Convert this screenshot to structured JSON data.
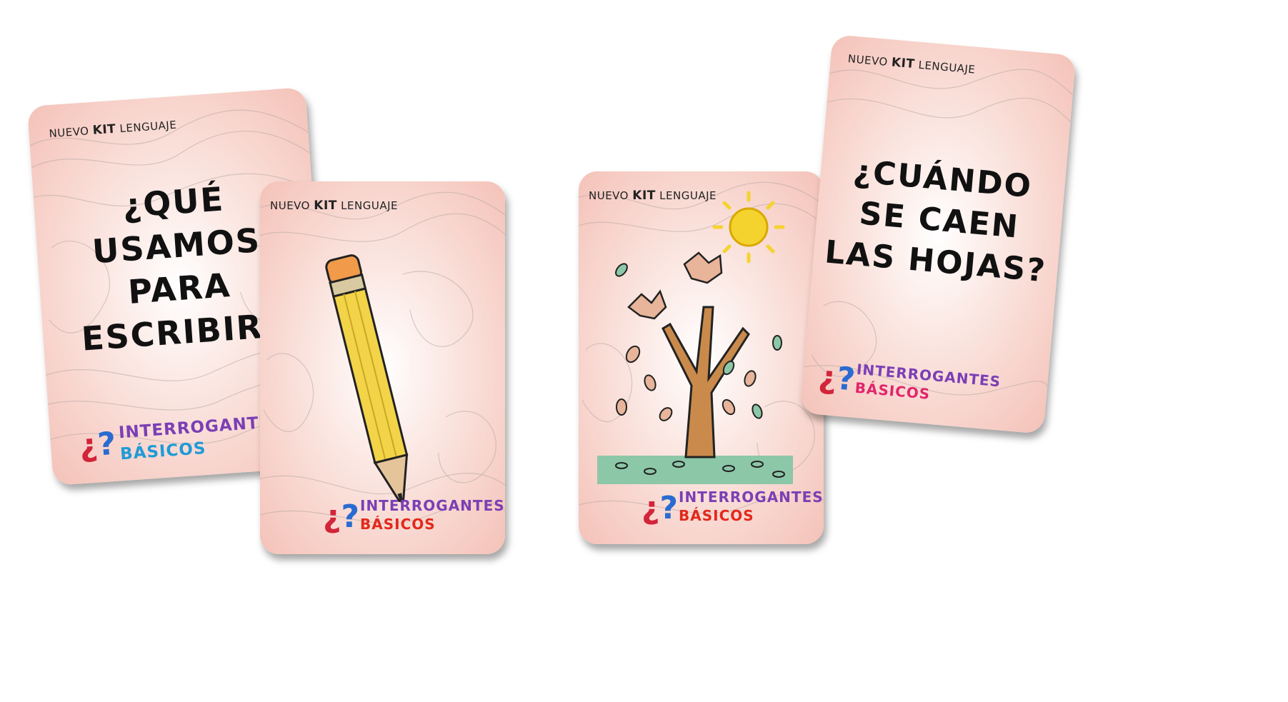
{
  "cards": [
    {
      "kit_prefix": "NUEVO",
      "kit_bold": "KIT",
      "kit_suffix": "LENGUAJE",
      "question_lines": [
        "¿QUÉ",
        "USAMOS",
        "PARA",
        "ESCRIBIR?"
      ],
      "logo_line1": "INTERROGANTES",
      "logo_line2": "BÁSICOS"
    },
    {
      "kit_prefix": "NUEVO",
      "kit_bold": "KIT",
      "kit_suffix": "LENGUAJE",
      "illustration": "pencil-illustration",
      "logo_line1": "INTERROGANTES",
      "logo_line2": "BÁSICOS"
    },
    {
      "kit_prefix": "NUEVO",
      "kit_bold": "KIT",
      "kit_suffix": "LENGUAJE",
      "illustration": "tree-falling-leaves-sun-illustration",
      "logo_line1": "INTERROGANTES",
      "logo_line2": "BÁSICOS"
    },
    {
      "kit_prefix": "NUEVO",
      "kit_bold": "KIT",
      "kit_suffix": "LENGUAJE",
      "question_lines": [
        "¿CUÁNDO",
        "SE CAEN",
        "LAS HOJAS?"
      ],
      "logo_line1": "INTERROGANTES",
      "logo_line2": "BÁSICOS"
    }
  ],
  "colors": {
    "card_pink": "#f4c2b8",
    "card_center": "#ffffff",
    "logo_red": "#d2243a",
    "logo_blue": "#2a6bd1",
    "pencil_yellow": "#f3d448",
    "trunk_brown": "#c98a4b",
    "grass_green": "#8cc7a8",
    "sun_yellow": "#f5d32f"
  }
}
